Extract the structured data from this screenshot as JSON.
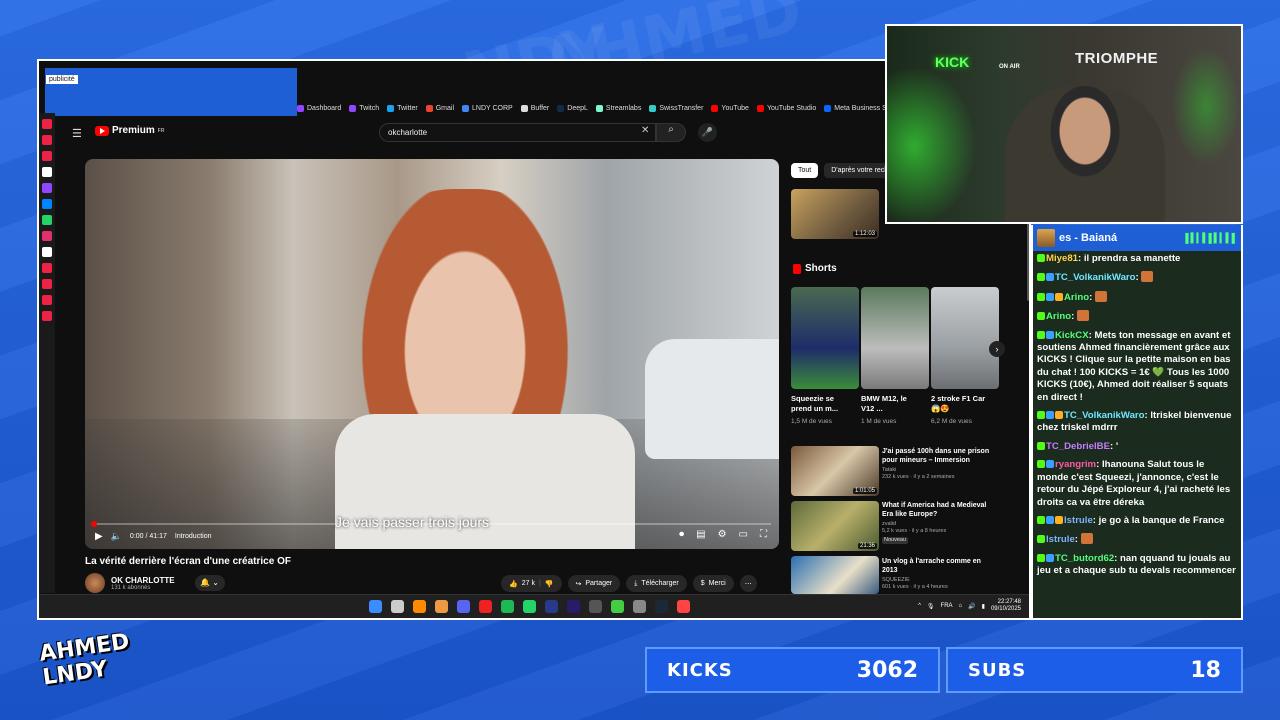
{
  "overlay": {
    "logo_lines": [
      "AHMED",
      "LNDY"
    ],
    "stats": [
      {
        "label": "KICKS",
        "value": "3062"
      },
      {
        "label": "SUBS",
        "value": "18"
      }
    ],
    "webcam": {
      "sign_left": "KICK",
      "sign_onair": "ON AIR",
      "sign_right": "TRIOMPHE"
    }
  },
  "browser": {
    "ad_label": "publicité",
    "bookmarks": [
      {
        "label": "Dashboard",
        "color": "#9146ff"
      },
      {
        "label": "Twitch",
        "color": "#9146ff"
      },
      {
        "label": "Twitter",
        "color": "#1da1f2"
      },
      {
        "label": "Gmail",
        "color": "#ea4335"
      },
      {
        "label": "LNDY CORP",
        "color": "#4285f4"
      },
      {
        "label": "Buffer",
        "color": "#dddddd"
      },
      {
        "label": "DeepL",
        "color": "#0f2b46"
      },
      {
        "label": "Streamlabs",
        "color": "#80f5d2"
      },
      {
        "label": "SwissTransfer",
        "color": "#3cc"
      },
      {
        "label": "YouTube",
        "color": "#ff0000"
      },
      {
        "label": "YouTube Studio",
        "color": "#ff0000"
      },
      {
        "label": "Meta Business Su",
        "color": "#0866ff"
      }
    ]
  },
  "youtube": {
    "logo_text": "Premium",
    "logo_region": "FR",
    "search_value": "okcharlotte",
    "video": {
      "subtitle": "Je vais passer trois jours",
      "time": "0:00 / 41:17",
      "chapter": "Introduction",
      "title": "La vérité derrière l'écran d'une créatrice OF",
      "channel": "OK CHARLOTTE",
      "subscribers": "131 k abonnés",
      "likes": "27 k",
      "share": "Partager",
      "download": "Télécharger",
      "thanks": "Merci"
    },
    "chips": [
      "Tout",
      "D'après votre rech"
    ],
    "top_thumb_duration": "1:12:03",
    "shorts_header": "Shorts",
    "shorts": [
      {
        "title": "Squeezie se prend un m...",
        "views": "1,5 M de vues"
      },
      {
        "title": "BMW M12, le V12 ...",
        "views": "1 M de vues"
      },
      {
        "title": "2 stroke F1 Car 😱😍",
        "views": "6,2 M de vues"
      }
    ],
    "related": [
      {
        "title": "J'ai passé 100h dans une prison pour mineurs – Immersion",
        "channel": "Tataki",
        "meta": "232 k vues · il y a 2 semaines",
        "duration": "1:01:05",
        "badge": ""
      },
      {
        "title": "What if America had a Medieval Era like Europe?",
        "channel": "zvalid",
        "meta": "5,2 k vues · il y a 8 heures",
        "duration": "21:36",
        "badge": "Nouveau"
      },
      {
        "title": "Un vlog à l'arrache comme en 2013",
        "channel": "SQUEEZIE",
        "meta": "601 k vues · il y a 4 heures",
        "duration": "",
        "badge": ""
      }
    ]
  },
  "taskbar": {
    "lang": "FRA",
    "time": "22:27:48",
    "date": "09/10/2025"
  },
  "chat": {
    "header": "es - Baianá",
    "messages": [
      {
        "user": "Miye81",
        "user_color": "#ffd24a",
        "text": "il prendra sa manette"
      },
      {
        "user": "TC_VolkanikWaro",
        "user_color": "#6ee7ff",
        "text": ""
      },
      {
        "user": "Arino",
        "user_color": "#53ff7a",
        "text": ""
      },
      {
        "user": "Arino",
        "user_color": "#53ff7a",
        "text": ""
      },
      {
        "user": "KickCX",
        "user_color": "#53ff7a",
        "text": "Mets ton message en avant et soutiens Ahmed financièrement grâce aux KICKS ! Clique sur la petite maison en bas du chat ! 100 KICKS = 1€ 💚 Tous les 1000 KICKS (10€), Ahmed doit réaliser 5 squats en direct !"
      },
      {
        "user": "TC_VolkanikWaro",
        "user_color": "#6ee7ff",
        "text": "ltriskel bienvenue chez triskel mdrrr"
      },
      {
        "user": "TC_DebrielBE",
        "user_color": "#c77dff",
        "text": "'"
      },
      {
        "user": "ryangrim",
        "user_color": "#ff5aa5",
        "text": "Ihanouna Salut tous le monde c'est Squeezi, j'annonce, c'est le retour du Jépé Exploreur 4, j'ai racheté les droits ca va être déreka"
      },
      {
        "user": "lstrule",
        "user_color": "#7fb3ff",
        "text": "je go à la banque de France"
      },
      {
        "user": "lstrule",
        "user_color": "#7fb3ff",
        "text": ""
      },
      {
        "user": "TC_butord62",
        "user_color": "#53ff7a",
        "text": "nan qquand tu jouals au jeu et a chaque sub tu devals recommencer"
      }
    ]
  }
}
